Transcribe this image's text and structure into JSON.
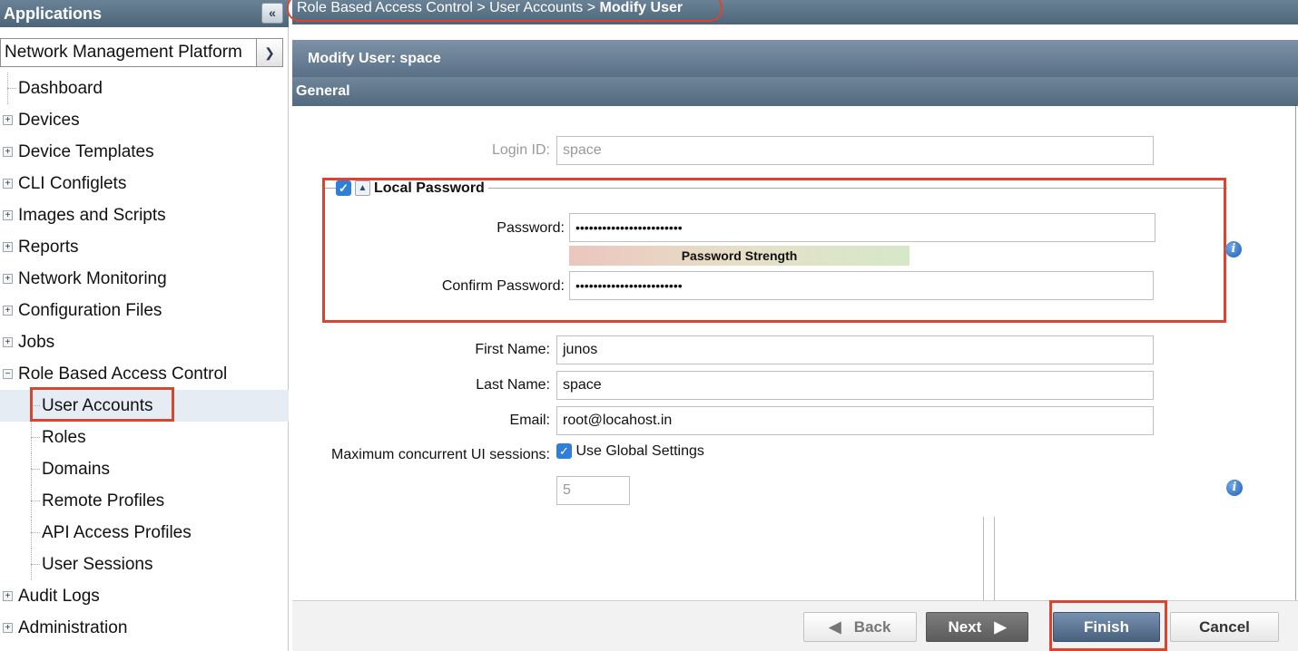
{
  "sidebar": {
    "header": "Applications",
    "collapse_glyph": "«",
    "app_select": {
      "value": "Network Management Platform"
    },
    "tree": {
      "dashboard": "Dashboard",
      "devices": "Devices",
      "device_templates": "Device Templates",
      "cli_configlets": "CLI Configlets",
      "images_scripts": "Images and Scripts",
      "reports": "Reports",
      "network_monitoring": "Network Monitoring",
      "configuration_files": "Configuration Files",
      "jobs": "Jobs",
      "rbac": "Role Based Access Control",
      "user_accounts": "User Accounts",
      "roles": "Roles",
      "domains": "Domains",
      "remote_profiles": "Remote Profiles",
      "api_access_profiles": "API Access Profiles",
      "user_sessions": "User Sessions",
      "audit_logs": "Audit Logs",
      "administration": "Administration"
    }
  },
  "breadcrumb": {
    "item1": "Role Based Access Control",
    "sep": ">",
    "item2": "User Accounts",
    "current": "Modify User"
  },
  "page": {
    "title": "Modify User: space",
    "section": "General"
  },
  "form": {
    "login_id": {
      "label": "Login ID:",
      "value": "space"
    },
    "local_password": {
      "legend": "Local Password",
      "checked": true,
      "password": {
        "label": "Password:",
        "value": "••••••••••••••••••••••••"
      },
      "strength_label": "Password Strength",
      "confirm": {
        "label": "Confirm Password:",
        "value": "••••••••••••••••••••••••"
      }
    },
    "first_name": {
      "label": "First Name:",
      "value": "junos"
    },
    "last_name": {
      "label": "Last Name:",
      "value": "space"
    },
    "email": {
      "label": "Email:",
      "value": "root@locahost.in"
    },
    "max_sessions": {
      "label": "Maximum concurrent UI sessions:",
      "checkbox_label": "Use Global Settings",
      "checked": true,
      "value": "5"
    }
  },
  "buttons": {
    "back": "Back",
    "next": "Next",
    "finish": "Finish",
    "cancel": "Cancel"
  },
  "colors": {
    "header": "#5a7087",
    "highlight": "#d9452e",
    "accent_blue": "#2f7fd8"
  }
}
